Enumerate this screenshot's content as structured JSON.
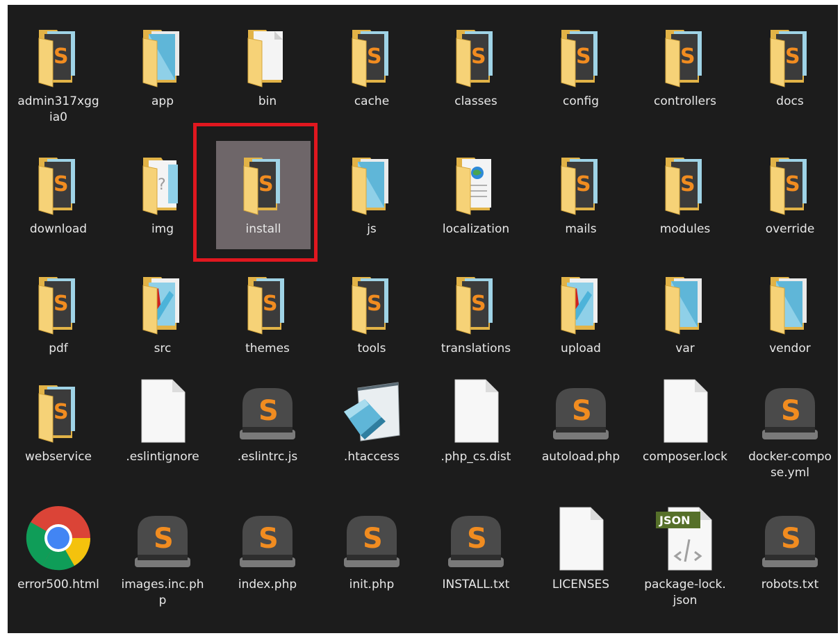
{
  "window": {
    "view": "large-icons"
  },
  "colors": {
    "background": "#1c1c1c",
    "text": "#e8e8e8",
    "selection": "#6e6669",
    "highlight": "#e0171f",
    "folder": "#f2c558",
    "sublime_orange": "#f18c20"
  },
  "items": [
    {
      "label": "admin317xggia0",
      "icon": "folder-sublime-icon",
      "selected": false
    },
    {
      "label": "app",
      "icon": "folder-docs-icon",
      "selected": false
    },
    {
      "label": "bin",
      "icon": "folder-blank-icon",
      "selected": false
    },
    {
      "label": "cache",
      "icon": "folder-sublime-icon",
      "selected": false
    },
    {
      "label": "classes",
      "icon": "folder-sublime-icon",
      "selected": false
    },
    {
      "label": "config",
      "icon": "folder-sublime-icon",
      "selected": false
    },
    {
      "label": "controllers",
      "icon": "folder-sublime-icon",
      "selected": false
    },
    {
      "label": "docs",
      "icon": "folder-sublime-icon",
      "selected": false
    },
    {
      "label": "download",
      "icon": "folder-sublime-icon",
      "selected": false
    },
    {
      "label": "img",
      "icon": "folder-unknown-icon",
      "selected": false
    },
    {
      "label": "install",
      "icon": "folder-sublime-icon",
      "selected": true
    },
    {
      "label": "js",
      "icon": "folder-docs-icon",
      "selected": false
    },
    {
      "label": "localization",
      "icon": "folder-web-icon",
      "selected": false
    },
    {
      "label": "mails",
      "icon": "folder-sublime-icon",
      "selected": false
    },
    {
      "label": "modules",
      "icon": "folder-sublime-icon",
      "selected": false
    },
    {
      "label": "override",
      "icon": "folder-sublime-icon",
      "selected": false
    },
    {
      "label": "pdf",
      "icon": "folder-sublime-icon",
      "selected": false
    },
    {
      "label": "src",
      "icon": "folder-image-icon",
      "selected": false
    },
    {
      "label": "themes",
      "icon": "folder-sublime-icon",
      "selected": false
    },
    {
      "label": "tools",
      "icon": "folder-sublime-icon",
      "selected": false
    },
    {
      "label": "translations",
      "icon": "folder-sublime-icon",
      "selected": false
    },
    {
      "label": "upload",
      "icon": "folder-image-icon",
      "selected": false
    },
    {
      "label": "var",
      "icon": "folder-docs-icon",
      "selected": false
    },
    {
      "label": "vendor",
      "icon": "folder-docs-icon",
      "selected": false
    },
    {
      "label": "webservice",
      "icon": "folder-sublime-icon",
      "selected": false
    },
    {
      "label": ".eslintignore",
      "icon": "blank-file-icon",
      "selected": false
    },
    {
      "label": ".eslintrc.js",
      "icon": "sublime-file-icon",
      "selected": false
    },
    {
      "label": ".htaccess",
      "icon": "notepad-icon",
      "selected": false
    },
    {
      "label": ".php_cs.dist",
      "icon": "blank-file-icon",
      "selected": false
    },
    {
      "label": "autoload.php",
      "icon": "sublime-file-icon",
      "selected": false
    },
    {
      "label": "composer.lock",
      "icon": "blank-file-icon",
      "selected": false
    },
    {
      "label": "docker-compose.yml",
      "icon": "sublime-file-icon",
      "selected": false
    },
    {
      "label": "error500.html",
      "icon": "chrome-icon",
      "selected": false
    },
    {
      "label": "images.inc.php",
      "icon": "sublime-file-icon",
      "selected": false
    },
    {
      "label": "index.php",
      "icon": "sublime-file-icon",
      "selected": false
    },
    {
      "label": "init.php",
      "icon": "sublime-file-icon",
      "selected": false
    },
    {
      "label": "INSTALL.txt",
      "icon": "sublime-file-icon",
      "selected": false
    },
    {
      "label": "LICENSES",
      "icon": "blank-file-icon",
      "selected": false
    },
    {
      "label": "package-lock.json",
      "icon": "json-file-icon",
      "selected": false,
      "badge": "JSON"
    },
    {
      "label": "robots.txt",
      "icon": "sublime-file-icon",
      "selected": false
    }
  ]
}
